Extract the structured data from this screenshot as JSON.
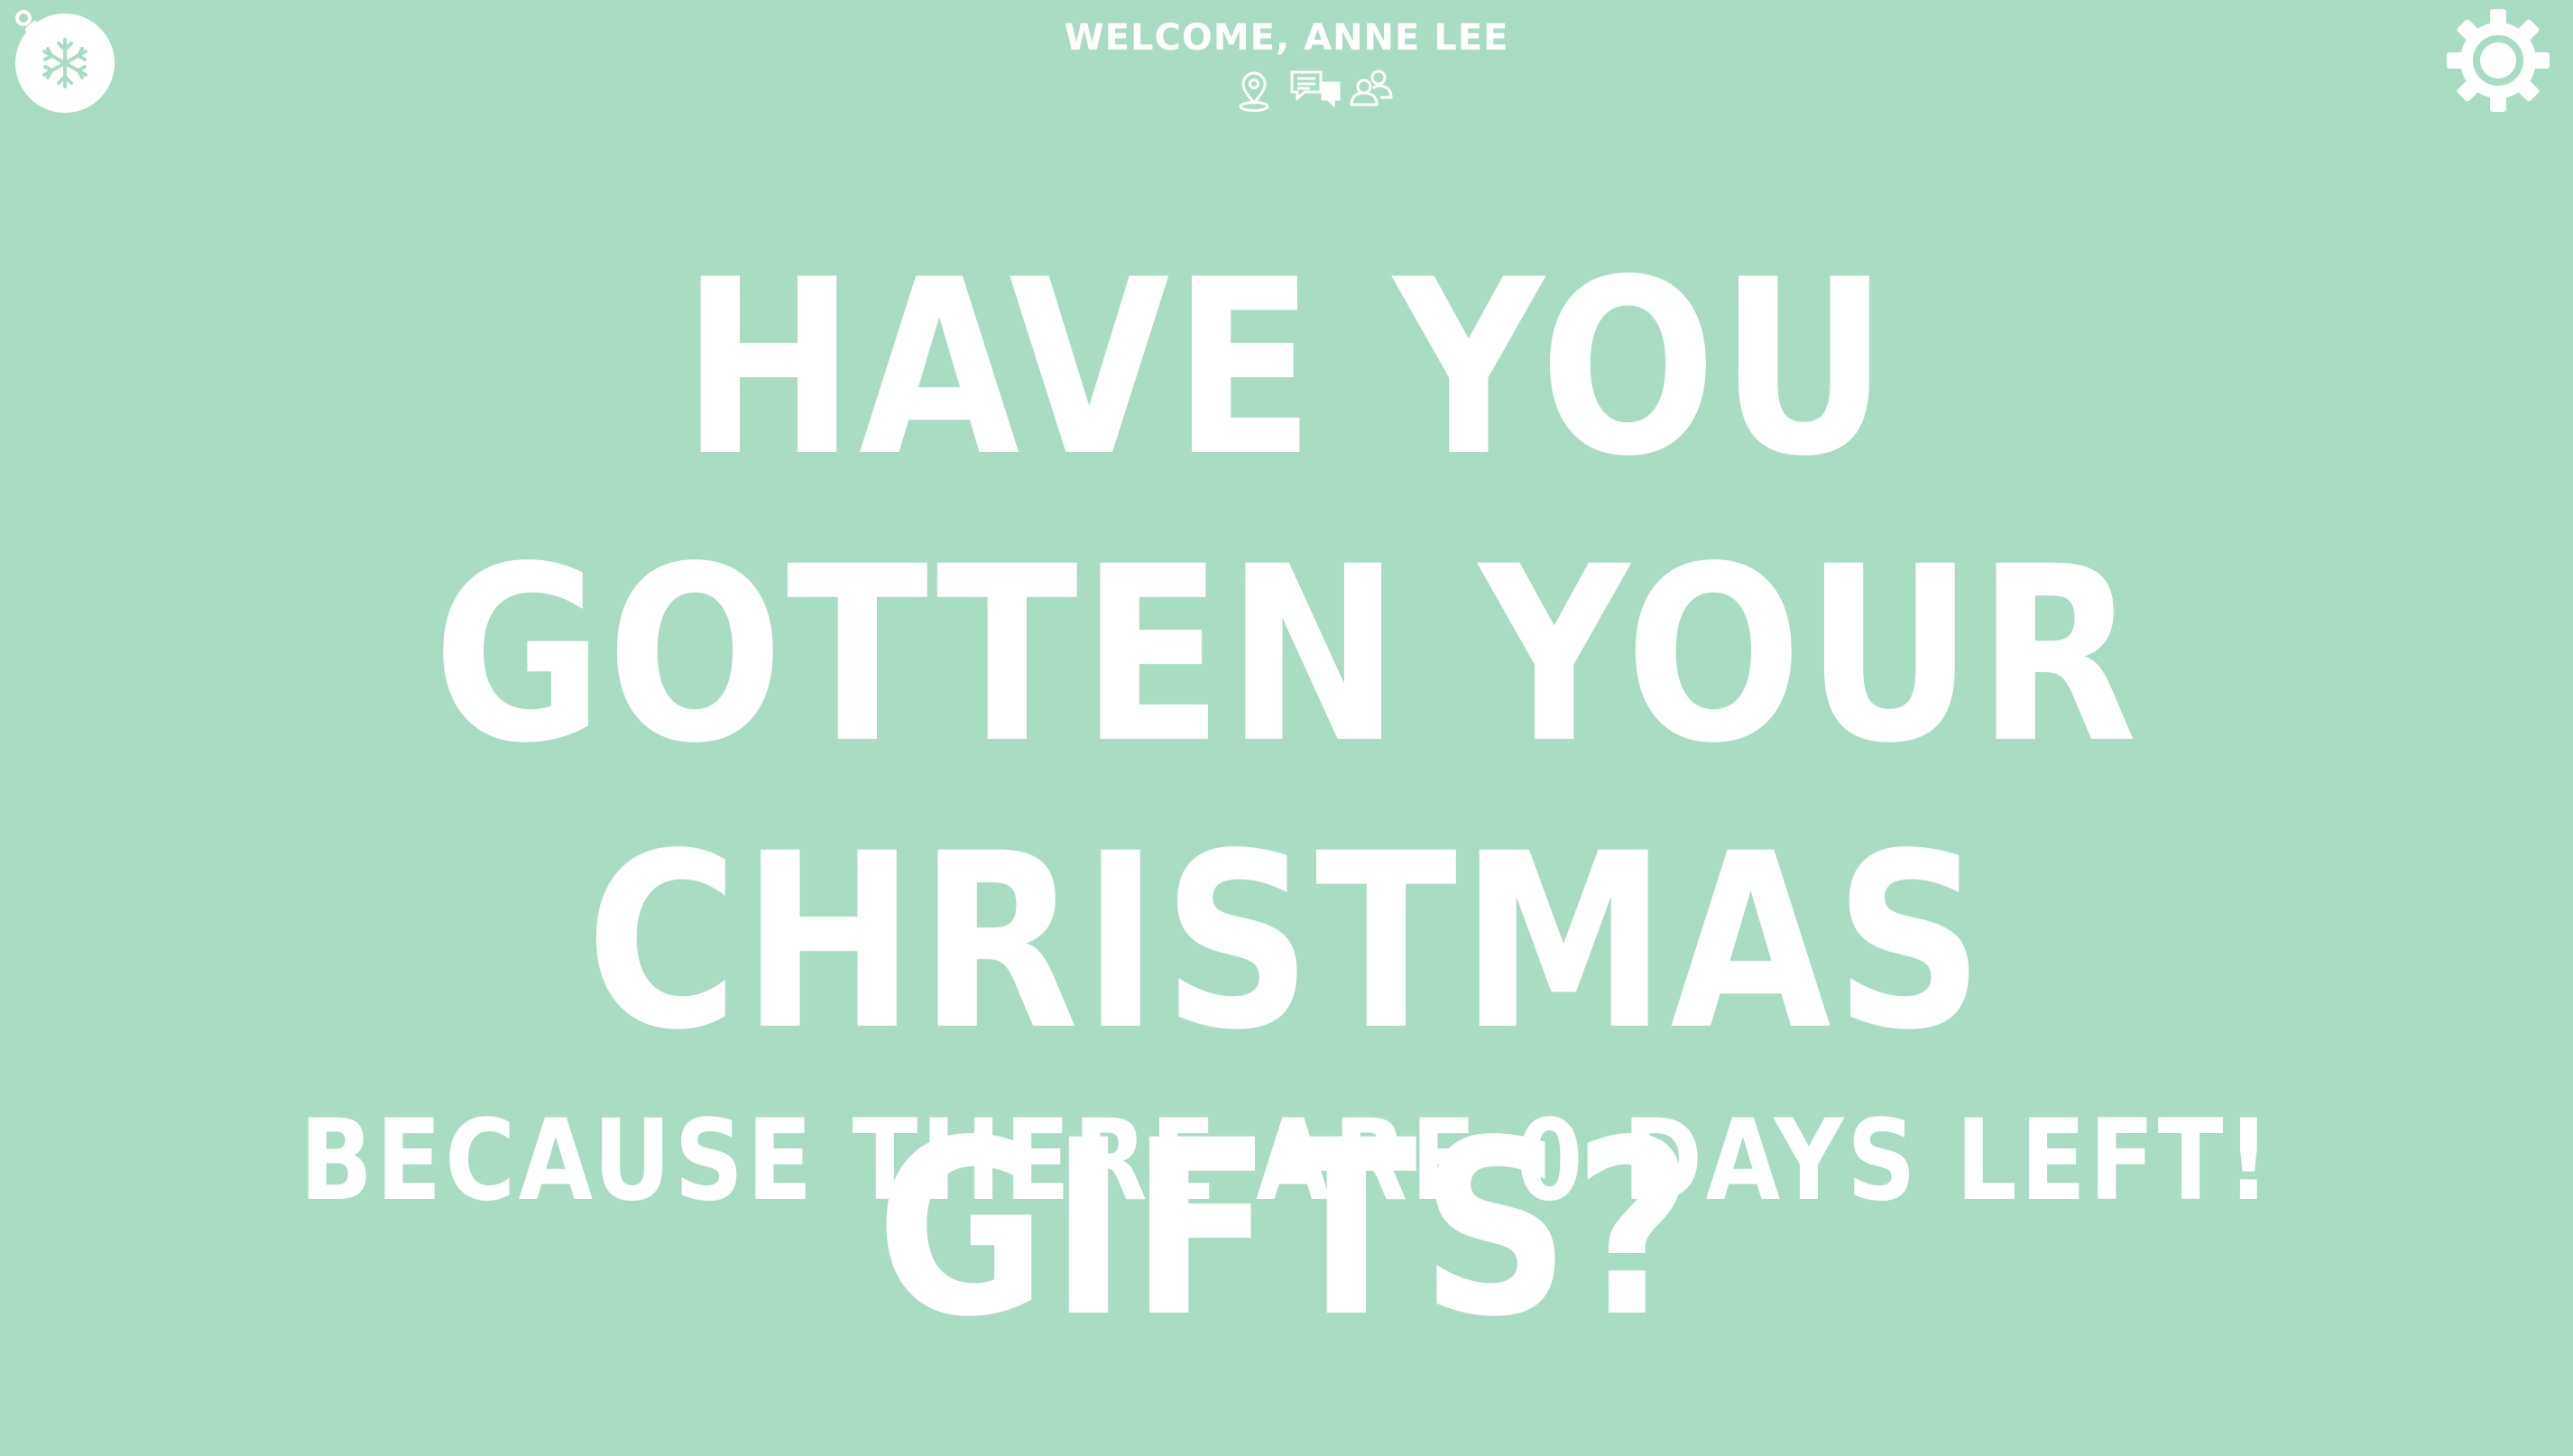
{
  "header": {
    "welcome_text": "WELCOME, ANNE LEE"
  },
  "icons": {
    "logo": "snowflake-ornament-icon",
    "settings": "gear-icon",
    "nav": [
      "map-pin-icon",
      "chat-icon",
      "users-icon"
    ]
  },
  "main": {
    "headline": "HAVE YOU GOTTEN YOUR CHRISTMAS GIFTS?",
    "subline": "BECAUSE THERE ARE 0 DAYS LEFT!"
  },
  "colors": {
    "background": "#a8dcc3",
    "foreground": "#ffffff"
  }
}
